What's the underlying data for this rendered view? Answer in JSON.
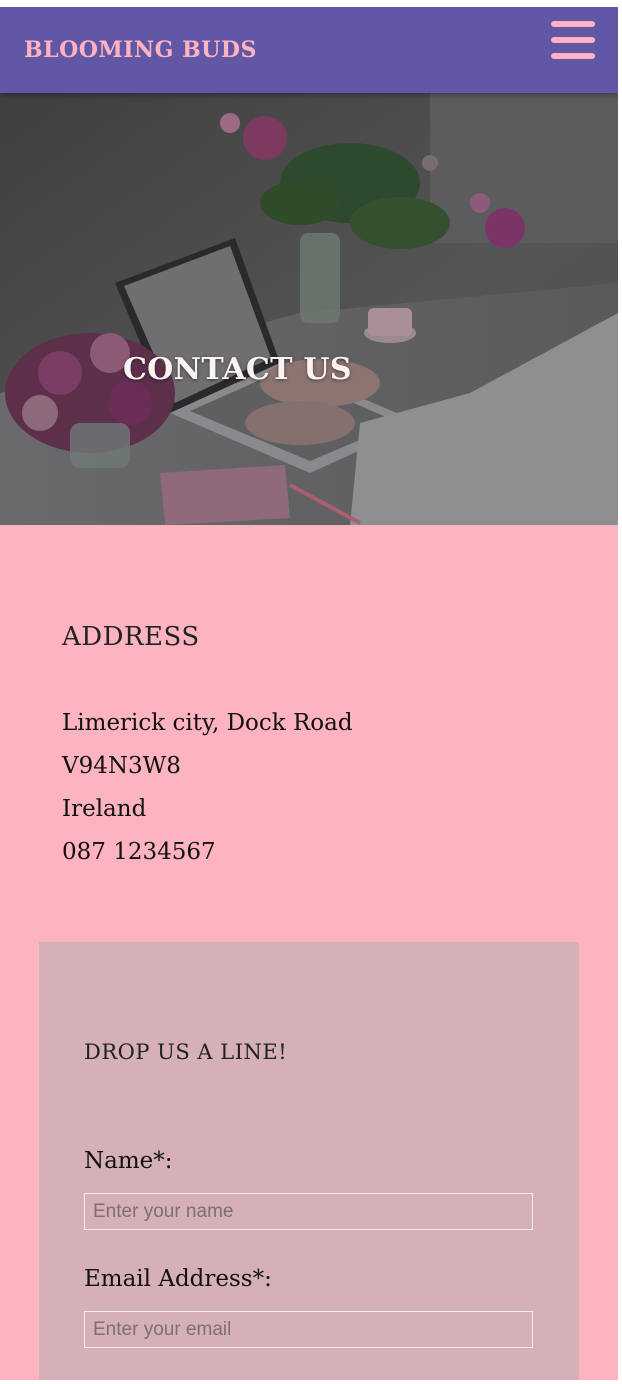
{
  "header": {
    "brand": "BLOOMING BUDS",
    "menu_icon": "hamburger-menu-icon"
  },
  "hero": {
    "title": "CONTACT US"
  },
  "address": {
    "heading": "ADDRESS",
    "lines": [
      "Limerick city, Dock Road",
      "V94N3W8",
      "Ireland",
      "087 1234567"
    ]
  },
  "contact_form": {
    "heading": "DROP US A LINE!",
    "name_label": "Name*:",
    "name_placeholder": "Enter your name",
    "email_label": "Email Address*:",
    "email_placeholder": "Enter your email"
  },
  "colors": {
    "header_bg": "#6257a5",
    "accent_pink": "#fdb3c0",
    "form_panel_bg": "#d5b0b7"
  }
}
